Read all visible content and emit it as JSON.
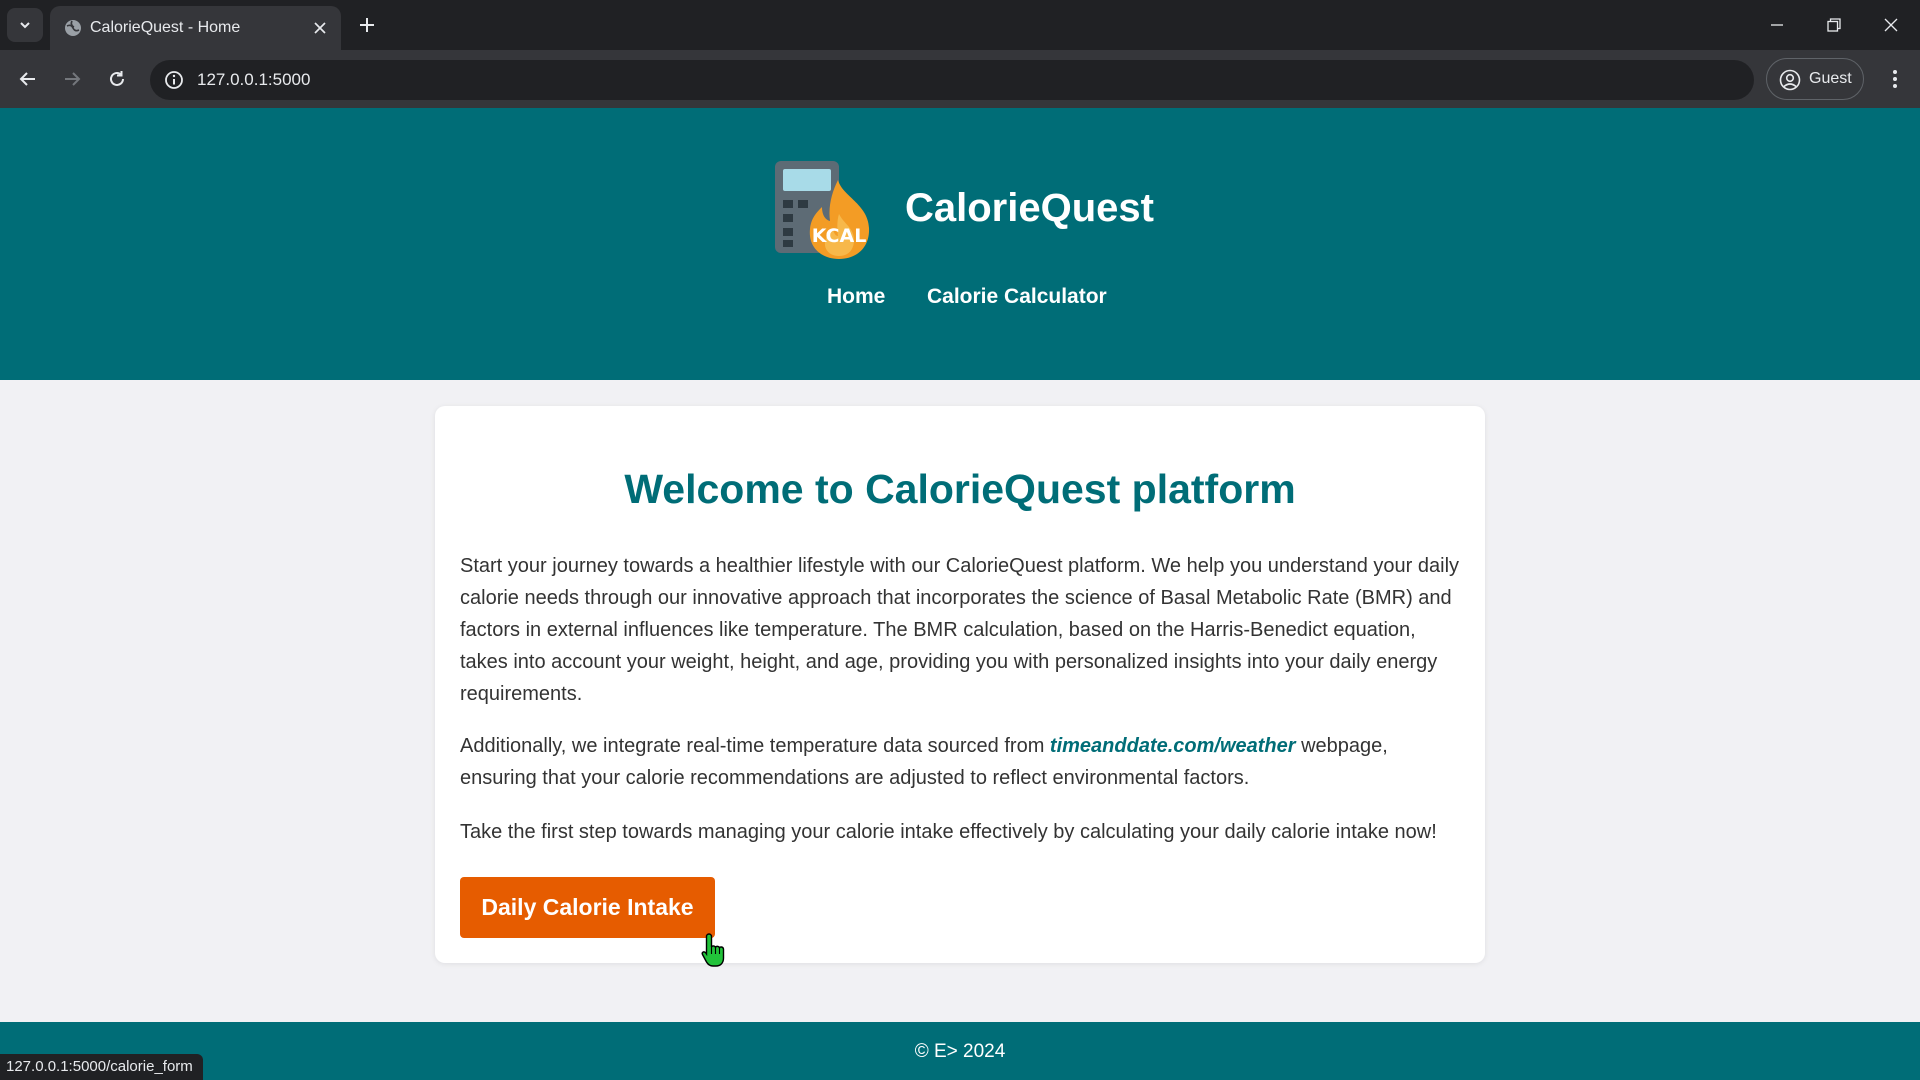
{
  "browser": {
    "tab_title": "CalorieQuest - Home",
    "url": "127.0.0.1:5000",
    "profile_label": "Guest",
    "status_url": "127.0.0.1:5000/calorie_form"
  },
  "header": {
    "brand_name": "CalorieQuest",
    "logo_text": "KCAL",
    "nav": {
      "home": "Home",
      "calculator": "Calorie Calculator"
    }
  },
  "main": {
    "title": "Welcome to CalorieQuest platform",
    "paragraph1": "Start your journey towards a healthier lifestyle with our CalorieQuest platform. We help you understand your daily calorie needs through our innovative approach that incorporates the science of Basal Metabolic Rate (BMR) and factors in external influences like temperature. The BMR calculation, based on the Harris-Benedict equation, takes into account your weight, height, and age, providing you with personalized insights into your daily energy requirements.",
    "paragraph2_before": "Additionally, we integrate real-time temperature data sourced from ",
    "paragraph2_link": "timeanddate.com/weather",
    "paragraph2_after": " webpage, ensuring that your calorie recommendations are adjusted to reflect environmental factors.",
    "paragraph3": "Take the first step towards managing your calorie intake effectively by calculating your daily calorie intake now!",
    "cta_label": "Daily Calorie Intake"
  },
  "footer": {
    "text": "© E>  2024"
  },
  "colors": {
    "brand_teal": "#006d77",
    "cta_orange": "#e65c00",
    "page_bg": "#f1f1f4",
    "chrome_dark": "#202124",
    "chrome_mid": "#35363a"
  },
  "icons": [
    "tab-search-icon",
    "globe-icon",
    "close-icon",
    "plus-icon",
    "minimize-icon",
    "restore-icon",
    "back-icon",
    "forward-icon",
    "reload-icon",
    "site-info-icon",
    "profile-icon",
    "more-menu-icon",
    "calculator-flame-logo",
    "hand-pointer-cursor"
  ]
}
